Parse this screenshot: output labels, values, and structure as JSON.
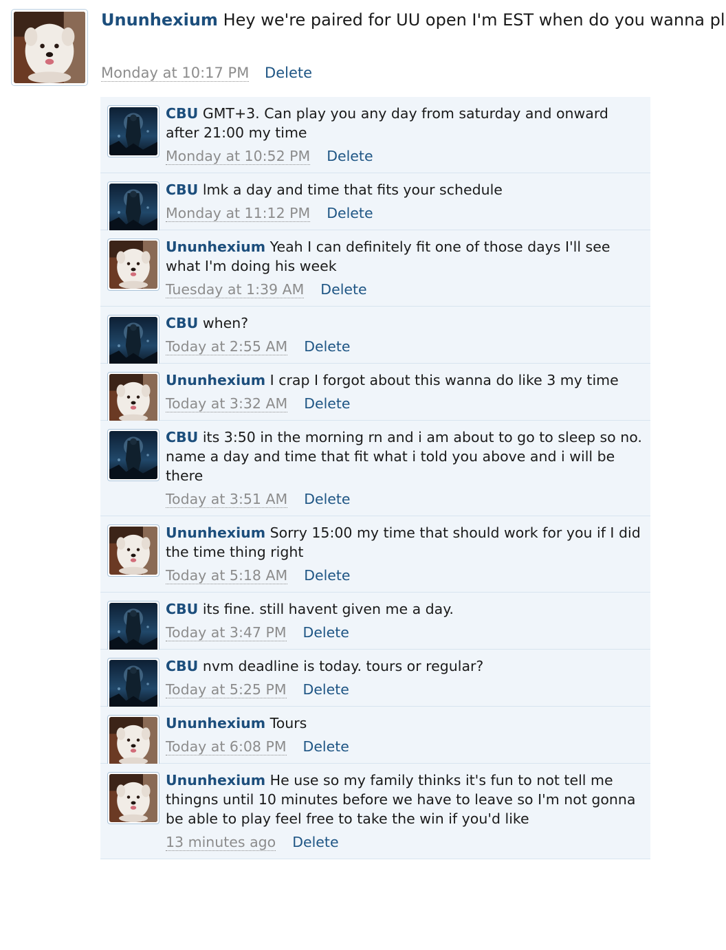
{
  "post": {
    "author": "Ununhexium",
    "text": "Hey we're paired for UU open I'm EST when do you wanna play",
    "time": "Monday at 10:17 PM",
    "delete_label": "Delete"
  },
  "comments": [
    {
      "author": "CBU",
      "avatar": "cbu",
      "text": "GMT+3. Can play you any day from saturday and onward after 21:00 my time",
      "time": "Monday at 10:52 PM",
      "delete_label": "Delete"
    },
    {
      "author": "CBU",
      "avatar": "cbu",
      "text": "lmk a day and time that fits your schedule",
      "time": "Monday at 11:12 PM",
      "delete_label": "Delete"
    },
    {
      "author": "Ununhexium",
      "avatar": "dog",
      "text": "Yeah I can definitely fit one of those days I'll see what I'm doing his week",
      "time": "Tuesday at 1:39 AM",
      "delete_label": "Delete"
    },
    {
      "author": "CBU",
      "avatar": "cbu",
      "text": "when?",
      "time": "Today at 2:55 AM",
      "delete_label": "Delete"
    },
    {
      "author": "Ununhexium",
      "avatar": "dog",
      "text": "I crap I forgot about this wanna do like 3 my time",
      "time": "Today at 3:32 AM",
      "delete_label": "Delete"
    },
    {
      "author": "CBU",
      "avatar": "cbu",
      "text": "its 3:50 in the morning rn and i am about to go to sleep so no. name a day and time that fit what i told you above and i will be there",
      "time": "Today at 3:51 AM",
      "delete_label": "Delete"
    },
    {
      "author": "Ununhexium",
      "avatar": "dog",
      "text": "Sorry 15:00 my time that should work for you if I did the time thing right",
      "time": "Today at 5:18 AM",
      "delete_label": "Delete"
    },
    {
      "author": "CBU",
      "avatar": "cbu",
      "text": "its fine. still havent given me a day.",
      "time": "Today at 3:47 PM",
      "delete_label": "Delete"
    },
    {
      "author": "CBU",
      "avatar": "cbu",
      "text": "nvm deadline is today. tours or regular?",
      "time": "Today at 5:25 PM",
      "delete_label": "Delete"
    },
    {
      "author": "Ununhexium",
      "avatar": "dog",
      "text": "Tours",
      "time": "Today at 6:08 PM",
      "delete_label": "Delete"
    },
    {
      "author": "Ununhexium",
      "avatar": "dog",
      "text": "He use so my family thinks it's fun to not tell me thingns until 10 minutes before we have to leave so I'm not gonna be able to play feel free to take the win if you'd like",
      "time": "13 minutes ago",
      "delete_label": "Delete"
    }
  ]
}
